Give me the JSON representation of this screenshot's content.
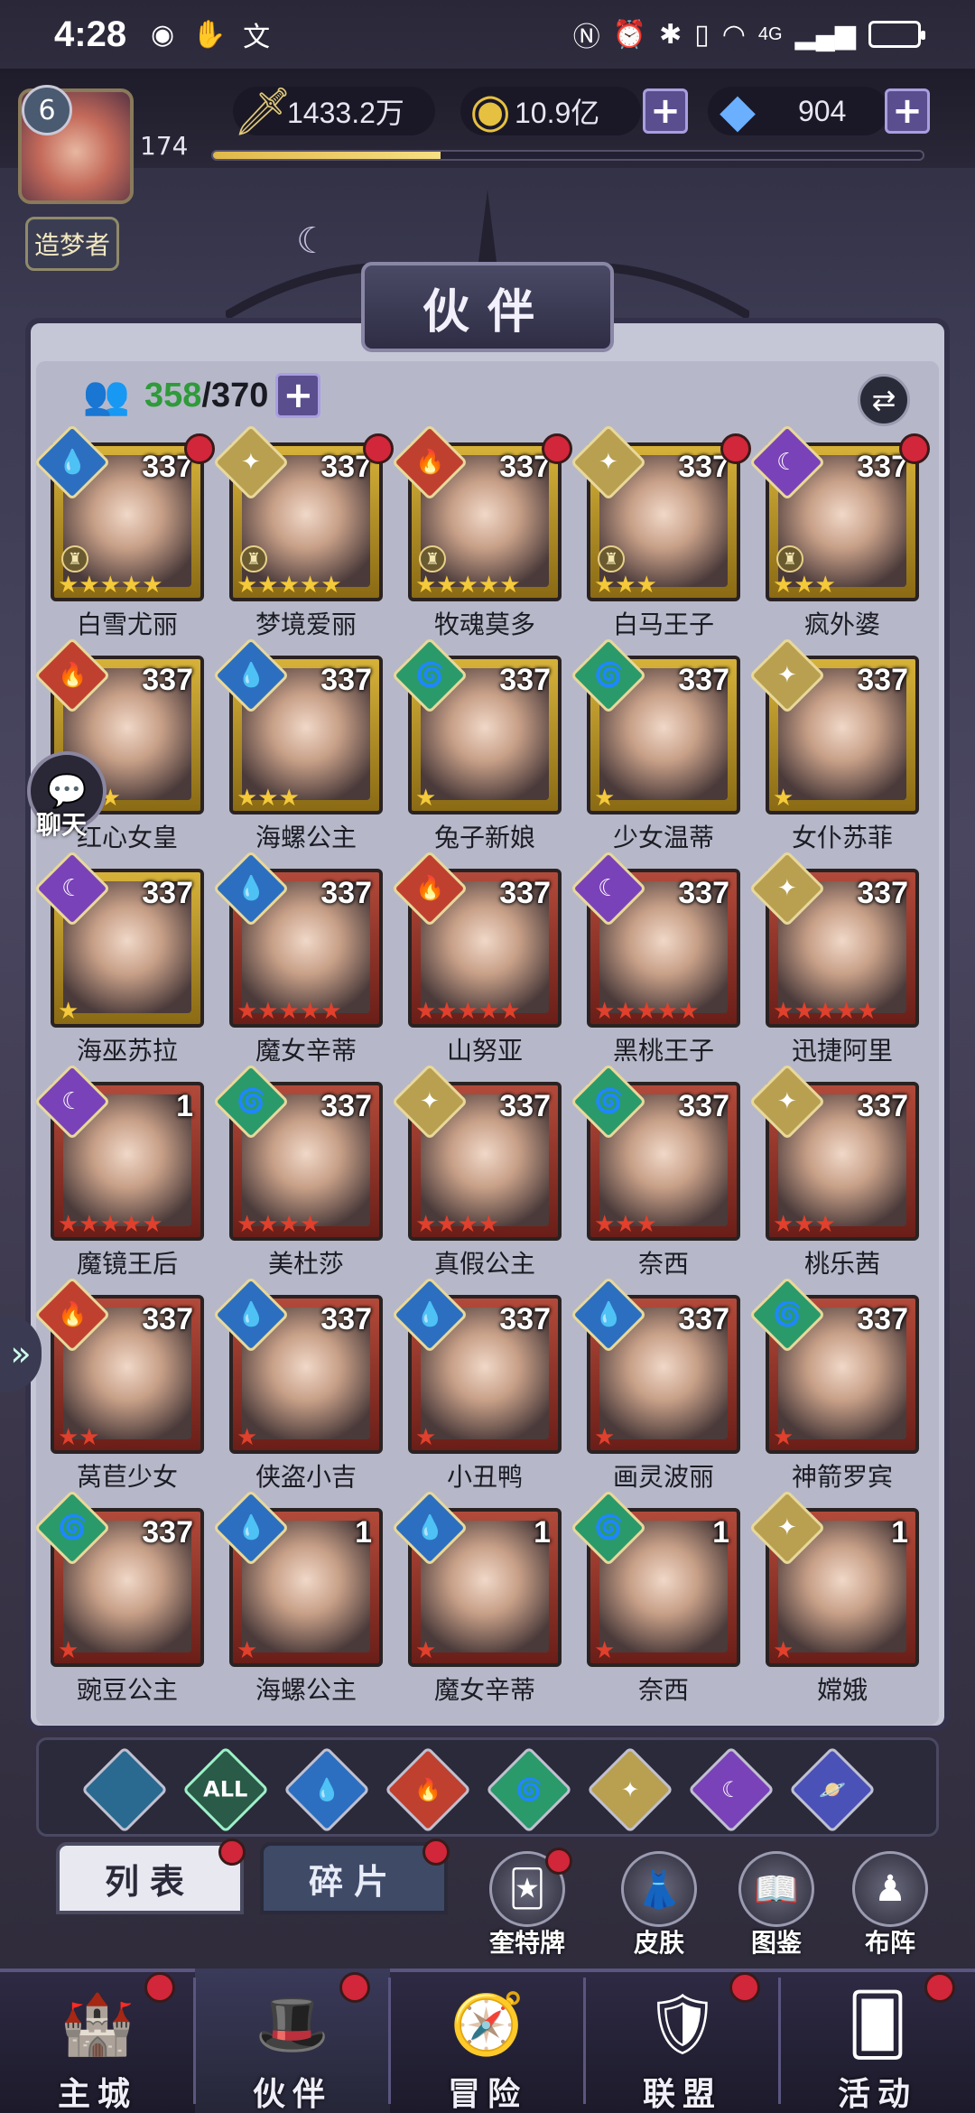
{
  "status_bar": {
    "time": "4:28",
    "network": "4G"
  },
  "player": {
    "level": "6",
    "number": "174",
    "title": "造梦者",
    "exp_progress": 0.32
  },
  "resources": {
    "power": "1433.2万",
    "gold": "10.9亿",
    "diamonds": "904"
  },
  "page": {
    "title": "伙伴"
  },
  "roster": {
    "owned": "358",
    "total": "/370"
  },
  "heroes": [
    {
      "name": "白雪尤丽",
      "level": "337",
      "element": "water",
      "frame": "gold",
      "stars": 5,
      "star_color": "gold",
      "reddot": true,
      "rook": true
    },
    {
      "name": "梦境爱丽",
      "level": "337",
      "element": "light",
      "frame": "gold",
      "stars": 5,
      "star_color": "gold",
      "reddot": true,
      "rook": true
    },
    {
      "name": "牧魂莫多",
      "level": "337",
      "element": "fire",
      "frame": "gold",
      "stars": 5,
      "star_color": "gold",
      "reddot": true,
      "rook": true
    },
    {
      "name": "白马王子",
      "level": "337",
      "element": "light",
      "frame": "gold",
      "stars": 3,
      "star_color": "gold",
      "reddot": true,
      "rook": true
    },
    {
      "name": "疯外婆",
      "level": "337",
      "element": "dark",
      "frame": "gold",
      "stars": 3,
      "star_color": "gold",
      "reddot": true,
      "rook": true
    },
    {
      "name": "红心女皇",
      "level": "337",
      "element": "fire",
      "frame": "gold",
      "stars": 3,
      "star_color": "gold",
      "reddot": false,
      "rook": false
    },
    {
      "name": "海螺公主",
      "level": "337",
      "element": "water",
      "frame": "gold",
      "stars": 3,
      "star_color": "gold",
      "reddot": false,
      "rook": false
    },
    {
      "name": "兔子新娘",
      "level": "337",
      "element": "wind",
      "frame": "gold",
      "stars": 1,
      "star_color": "gold",
      "reddot": false,
      "rook": false
    },
    {
      "name": "少女温蒂",
      "level": "337",
      "element": "wind",
      "frame": "gold",
      "stars": 1,
      "star_color": "gold",
      "reddot": false,
      "rook": false
    },
    {
      "name": "女仆苏菲",
      "level": "337",
      "element": "light",
      "frame": "gold",
      "stars": 1,
      "star_color": "gold",
      "reddot": false,
      "rook": false
    },
    {
      "name": "海巫苏拉",
      "level": "337",
      "element": "dark",
      "frame": "gold",
      "stars": 1,
      "star_color": "gold",
      "reddot": false,
      "rook": false
    },
    {
      "name": "魔女辛蒂",
      "level": "337",
      "element": "water",
      "frame": "red",
      "stars": 5,
      "star_color": "red",
      "reddot": false,
      "rook": false
    },
    {
      "name": "山努亚",
      "level": "337",
      "element": "fire",
      "frame": "red",
      "stars": 5,
      "star_color": "red",
      "reddot": false,
      "rook": false
    },
    {
      "name": "黑桃王子",
      "level": "337",
      "element": "dark",
      "frame": "red",
      "stars": 5,
      "star_color": "red",
      "reddot": false,
      "rook": false
    },
    {
      "name": "迅捷阿里",
      "level": "337",
      "element": "light",
      "frame": "red",
      "stars": 5,
      "star_color": "red",
      "reddot": false,
      "rook": false
    },
    {
      "name": "魔镜王后",
      "level": "1",
      "element": "dark",
      "frame": "red",
      "stars": 5,
      "star_color": "red",
      "reddot": false,
      "rook": false
    },
    {
      "name": "美杜莎",
      "level": "337",
      "element": "wind",
      "frame": "red",
      "stars": 4,
      "star_color": "red",
      "reddot": false,
      "rook": false
    },
    {
      "name": "真假公主",
      "level": "337",
      "element": "light",
      "frame": "red",
      "stars": 4,
      "star_color": "red",
      "reddot": false,
      "rook": false
    },
    {
      "name": "奈西",
      "level": "337",
      "element": "wind",
      "frame": "red",
      "stars": 3,
      "star_color": "red",
      "reddot": false,
      "rook": false
    },
    {
      "name": "桃乐茜",
      "level": "337",
      "element": "light",
      "frame": "red",
      "stars": 3,
      "star_color": "red",
      "reddot": false,
      "rook": false
    },
    {
      "name": "莴苣少女",
      "level": "337",
      "element": "fire",
      "frame": "red",
      "stars": 2,
      "star_color": "red",
      "reddot": false,
      "rook": false
    },
    {
      "name": "侠盗小吉",
      "level": "337",
      "element": "water",
      "frame": "red",
      "stars": 1,
      "star_color": "red",
      "reddot": false,
      "rook": false
    },
    {
      "name": "小丑鸭",
      "level": "337",
      "element": "water",
      "frame": "red",
      "stars": 1,
      "star_color": "red",
      "reddot": false,
      "rook": false
    },
    {
      "name": "画灵波丽",
      "level": "337",
      "element": "water",
      "frame": "red",
      "stars": 1,
      "star_color": "red",
      "reddot": false,
      "rook": false
    },
    {
      "name": "神箭罗宾",
      "level": "337",
      "element": "wind",
      "frame": "red",
      "stars": 1,
      "star_color": "red",
      "reddot": false,
      "rook": false
    },
    {
      "name": "豌豆公主",
      "level": "337",
      "element": "wind",
      "frame": "red",
      "stars": 1,
      "star_color": "red",
      "reddot": false,
      "rook": false
    },
    {
      "name": "海螺公主",
      "level": "1",
      "element": "water",
      "frame": "red",
      "stars": 1,
      "star_color": "red",
      "reddot": false,
      "rook": false
    },
    {
      "name": "魔女辛蒂",
      "level": "1",
      "element": "water",
      "frame": "red",
      "stars": 1,
      "star_color": "red",
      "reddot": false,
      "rook": false
    },
    {
      "name": "奈西",
      "level": "1",
      "element": "wind",
      "frame": "red",
      "stars": 1,
      "star_color": "red",
      "reddot": false,
      "rook": false
    },
    {
      "name": "嫦娥",
      "level": "1",
      "element": "light",
      "frame": "red",
      "stars": 1,
      "star_color": "red",
      "reddot": false,
      "rook": false
    }
  ],
  "chat": {
    "label": "聊天"
  },
  "filters": [
    {
      "name": "none",
      "label": ""
    },
    {
      "name": "all",
      "label": "ALL"
    },
    {
      "name": "water",
      "label": "💧"
    },
    {
      "name": "fire",
      "label": "🔥"
    },
    {
      "name": "wind",
      "label": "🌀"
    },
    {
      "name": "light",
      "label": "✦"
    },
    {
      "name": "dark",
      "label": "☾"
    },
    {
      "name": "cosmic",
      "label": "🪐"
    }
  ],
  "tabs": {
    "list": "列表",
    "fragments": "碎片"
  },
  "tools": [
    {
      "label": "奎特牌",
      "icon": "🃏",
      "reddot": true
    },
    {
      "label": "皮肤",
      "icon": "👗",
      "reddot": false
    },
    {
      "label": "图鉴",
      "icon": "📖",
      "reddot": false
    },
    {
      "label": "布阵",
      "icon": "♟",
      "reddot": false
    }
  ],
  "nav": [
    {
      "label": "主城",
      "icon": "🏰",
      "reddot": true,
      "active": false
    },
    {
      "label": "伙伴",
      "icon": "🎩",
      "reddot": true,
      "active": true
    },
    {
      "label": "冒险",
      "icon": "🧭",
      "reddot": false,
      "active": false
    },
    {
      "label": "联盟",
      "icon": "🛡",
      "reddot": true,
      "active": false
    },
    {
      "label": "活动",
      "icon": "🂠",
      "reddot": true,
      "active": false
    }
  ],
  "colors": {
    "accent": "#5a4e8e",
    "reddot": "#d2263a",
    "green_count": "#2f9a3a"
  }
}
